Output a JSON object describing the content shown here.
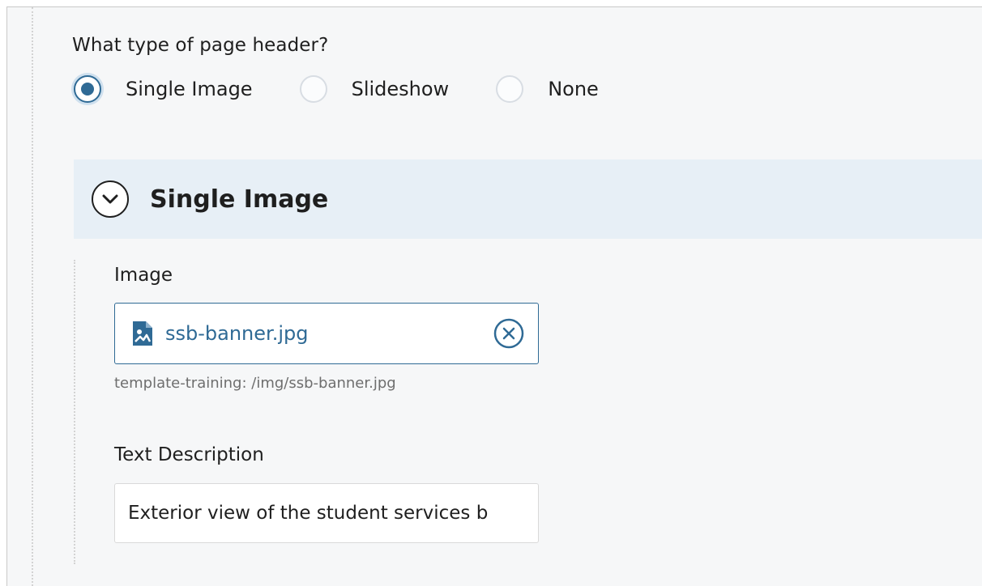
{
  "form": {
    "question": "What type of page header?",
    "header_type_options": [
      {
        "label": "Single Image",
        "selected": true
      },
      {
        "label": "Slideshow",
        "selected": false
      },
      {
        "label": "None",
        "selected": false
      }
    ]
  },
  "section": {
    "title": "Single Image",
    "icon": "chevron-down-circle-icon"
  },
  "image_field": {
    "label": "Image",
    "file_name": "ssb-banner.jpg",
    "file_icon": "image-file-icon",
    "clear_icon": "clear-circle-icon",
    "path": "template-training: /img/ssb-banner.jpg"
  },
  "description_field": {
    "label": "Text Description",
    "value": "Exterior view of the student services b"
  },
  "colors": {
    "accent": "#2f6a95",
    "section_header_bg": "#e7eff6",
    "panel_bg": "#f6f7f8",
    "muted_text": "#6e6e6e"
  }
}
